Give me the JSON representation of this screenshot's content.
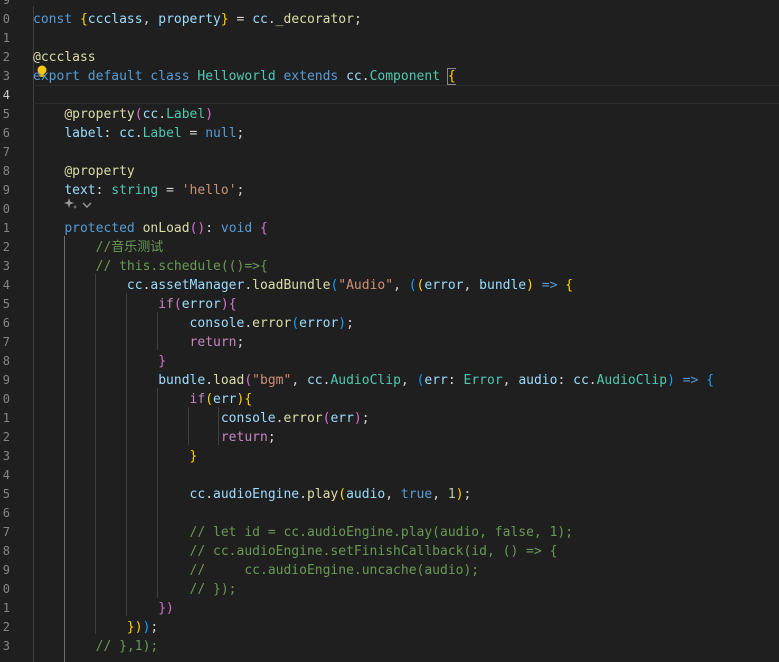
{
  "editor": {
    "line_numbers": [
      "9",
      "0",
      "1",
      "2",
      "3",
      "4",
      "5",
      "6",
      "7",
      "8",
      "9",
      "0",
      "1",
      "2",
      "3",
      "4",
      "5",
      "6",
      "7",
      "8",
      "9",
      "0",
      "1",
      "2",
      "3",
      "4",
      "5",
      "6",
      "7",
      "8",
      "9",
      "0",
      "1",
      "2",
      "3"
    ],
    "active_line_index": 5,
    "lightbulb_icon": "lightbulb-icon",
    "codelens_icons": [
      "sparkle-icon",
      "chevron-down-icon"
    ],
    "lines": [
      [],
      [
        [
          "kw",
          "const "
        ],
        [
          "br1",
          "{"
        ],
        [
          "var",
          "ccclass"
        ],
        [
          "txt",
          ", "
        ],
        [
          "var",
          "property"
        ],
        [
          "br1",
          "}"
        ],
        [
          "txt",
          " = "
        ],
        [
          "var",
          "cc"
        ],
        [
          "txt",
          "."
        ],
        [
          "fn",
          "_decorator"
        ],
        [
          "txt",
          ";"
        ]
      ],
      [],
      [
        [
          "fn",
          "@ccclass"
        ]
      ],
      [
        [
          "kw",
          "export default class "
        ],
        [
          "cls",
          "Helloworld "
        ],
        [
          "kw",
          "extends "
        ],
        [
          "var",
          "cc"
        ],
        [
          "txt",
          "."
        ],
        [
          "cls",
          "Component "
        ],
        [
          "br1",
          "{"
        ]
      ],
      [],
      [
        [
          "txt",
          "    "
        ],
        [
          "fn",
          "@property"
        ],
        [
          "br2",
          "("
        ],
        [
          "var",
          "cc"
        ],
        [
          "txt",
          "."
        ],
        [
          "cls",
          "Label"
        ],
        [
          "br2",
          ")"
        ]
      ],
      [
        [
          "txt",
          "    "
        ],
        [
          "var",
          "label"
        ],
        [
          "txt",
          ": "
        ],
        [
          "var",
          "cc"
        ],
        [
          "txt",
          "."
        ],
        [
          "cls",
          "Label"
        ],
        [
          "txt",
          " = "
        ],
        [
          "kw",
          "null"
        ],
        [
          "txt",
          ";"
        ]
      ],
      [],
      [
        [
          "txt",
          "    "
        ],
        [
          "fn",
          "@property"
        ]
      ],
      [
        [
          "txt",
          "    "
        ],
        [
          "var",
          "text"
        ],
        [
          "txt",
          ": "
        ],
        [
          "cls",
          "string"
        ],
        [
          "txt",
          " = "
        ],
        [
          "str",
          "'hello'"
        ],
        [
          "txt",
          ";"
        ]
      ],
      [],
      [
        [
          "txt",
          "    "
        ],
        [
          "kw",
          "protected "
        ],
        [
          "fn",
          "onLoad"
        ],
        [
          "br2",
          "()"
        ],
        [
          "txt",
          ": "
        ],
        [
          "kw",
          "void "
        ],
        [
          "br2",
          "{"
        ]
      ],
      [
        [
          "txt",
          "        "
        ],
        [
          "com",
          "//音乐测试"
        ]
      ],
      [
        [
          "txt",
          "        "
        ],
        [
          "com",
          "// this.schedule(()=>{"
        ]
      ],
      [
        [
          "txt",
          "            "
        ],
        [
          "var",
          "cc"
        ],
        [
          "txt",
          "."
        ],
        [
          "var",
          "assetManager"
        ],
        [
          "txt",
          "."
        ],
        [
          "fn",
          "loadBundle"
        ],
        [
          "br3",
          "("
        ],
        [
          "str",
          "\"Audio\""
        ],
        [
          "txt",
          ", "
        ],
        [
          "br3",
          "("
        ],
        [
          "br1",
          "("
        ],
        [
          "var",
          "error"
        ],
        [
          "txt",
          ", "
        ],
        [
          "var",
          "bundle"
        ],
        [
          "br1",
          ")"
        ],
        [
          "kw",
          " => "
        ],
        [
          "br1",
          "{"
        ]
      ],
      [
        [
          "txt",
          "                "
        ],
        [
          "ctl",
          "if"
        ],
        [
          "br2",
          "("
        ],
        [
          "var",
          "error"
        ],
        [
          "br2",
          ")"
        ],
        [
          "br2",
          "{"
        ]
      ],
      [
        [
          "txt",
          "                    "
        ],
        [
          "var",
          "console"
        ],
        [
          "txt",
          "."
        ],
        [
          "fn",
          "error"
        ],
        [
          "br3",
          "("
        ],
        [
          "var",
          "error"
        ],
        [
          "br3",
          ")"
        ],
        [
          "txt",
          ";"
        ]
      ],
      [
        [
          "txt",
          "                    "
        ],
        [
          "ctl",
          "return"
        ],
        [
          "txt",
          ";"
        ]
      ],
      [
        [
          "txt",
          "                "
        ],
        [
          "br2",
          "}"
        ]
      ],
      [
        [
          "txt",
          "                "
        ],
        [
          "var",
          "bundle"
        ],
        [
          "txt",
          "."
        ],
        [
          "fn",
          "load"
        ],
        [
          "br2",
          "("
        ],
        [
          "str",
          "\"bgm\""
        ],
        [
          "txt",
          ", "
        ],
        [
          "var",
          "cc"
        ],
        [
          "txt",
          "."
        ],
        [
          "cls",
          "AudioClip"
        ],
        [
          "txt",
          ", "
        ],
        [
          "br3",
          "("
        ],
        [
          "var",
          "err"
        ],
        [
          "txt",
          ": "
        ],
        [
          "cls",
          "Error"
        ],
        [
          "txt",
          ", "
        ],
        [
          "var",
          "audio"
        ],
        [
          "txt",
          ": "
        ],
        [
          "var",
          "cc"
        ],
        [
          "txt",
          "."
        ],
        [
          "cls",
          "AudioClip"
        ],
        [
          "br3",
          ")"
        ],
        [
          "kw",
          " => "
        ],
        [
          "br3",
          "{"
        ]
      ],
      [
        [
          "txt",
          "                    "
        ],
        [
          "ctl",
          "if"
        ],
        [
          "br1",
          "("
        ],
        [
          "var",
          "err"
        ],
        [
          "br1",
          ")"
        ],
        [
          "br1",
          "{"
        ]
      ],
      [
        [
          "txt",
          "                        "
        ],
        [
          "var",
          "console"
        ],
        [
          "txt",
          "."
        ],
        [
          "fn",
          "error"
        ],
        [
          "br2",
          "("
        ],
        [
          "var",
          "err"
        ],
        [
          "br2",
          ")"
        ],
        [
          "txt",
          ";"
        ]
      ],
      [
        [
          "txt",
          "                        "
        ],
        [
          "ctl",
          "return"
        ],
        [
          "txt",
          ";"
        ]
      ],
      [
        [
          "txt",
          "                    "
        ],
        [
          "br1",
          "}"
        ]
      ],
      [],
      [
        [
          "txt",
          "                    "
        ],
        [
          "var",
          "cc"
        ],
        [
          "txt",
          "."
        ],
        [
          "var",
          "audioEngine"
        ],
        [
          "txt",
          "."
        ],
        [
          "fn",
          "play"
        ],
        [
          "br1",
          "("
        ],
        [
          "var",
          "audio"
        ],
        [
          "txt",
          ", "
        ],
        [
          "kw",
          "true"
        ],
        [
          "txt",
          ", "
        ],
        [
          "num",
          "1"
        ],
        [
          "br1",
          ")"
        ],
        [
          "txt",
          ";"
        ]
      ],
      [],
      [
        [
          "txt",
          "                    "
        ],
        [
          "com",
          "// let id = cc.audioEngine.play(audio, false, 1);"
        ]
      ],
      [
        [
          "txt",
          "                    "
        ],
        [
          "com",
          "// cc.audioEngine.setFinishCallback(id, () => {"
        ]
      ],
      [
        [
          "txt",
          "                    "
        ],
        [
          "com",
          "//     cc.audioEngine.uncache(audio);"
        ]
      ],
      [
        [
          "txt",
          "                    "
        ],
        [
          "com",
          "// });"
        ]
      ],
      [
        [
          "txt",
          "                "
        ],
        [
          "br2",
          "})"
        ]
      ],
      [
        [
          "txt",
          "            "
        ],
        [
          "br1",
          "})"
        ],
        [
          "br3",
          ")"
        ],
        [
          "txt",
          ";"
        ]
      ],
      [
        [
          "txt",
          "        "
        ],
        [
          "com",
          "// },1);"
        ]
      ]
    ]
  }
}
